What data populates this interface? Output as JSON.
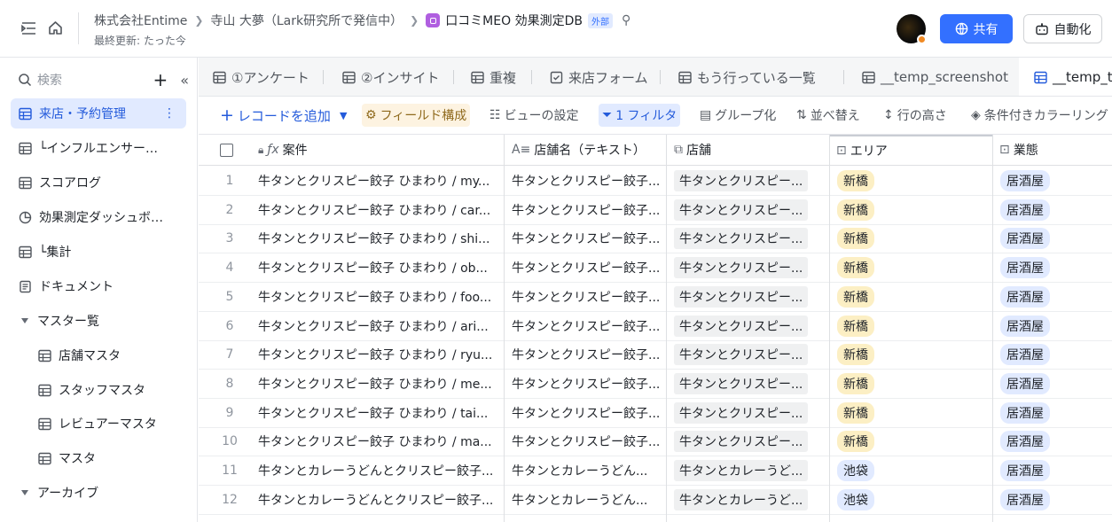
{
  "header": {
    "breadcrumbs": [
      "株式会社Entime",
      "寺山 大夢（Lark研究所で発信中）"
    ],
    "doc_title": "口コミMEO 効果測定DB",
    "external_badge": "外部",
    "last_updated": "最終更新: たった今",
    "share_label": "共有",
    "automation_label": "自動化",
    "accent": "#3370ff"
  },
  "sidebar": {
    "search_placeholder": "検索",
    "items": [
      {
        "label": "来店・予約管理",
        "icon": "table-icon",
        "active": true
      },
      {
        "label": "└インフルエンサー…",
        "icon": "table-icon"
      },
      {
        "label": "スコアログ",
        "icon": "table-icon"
      },
      {
        "label": "効果測定ダッシュボ…",
        "icon": "dashboard-icon"
      },
      {
        "label": "└集計",
        "icon": "table-icon"
      },
      {
        "label": "ドキュメント",
        "icon": "doc-icon"
      },
      {
        "label": "マスター覧",
        "icon": "folder-caret",
        "folder": true
      },
      {
        "label": "店舗マスタ",
        "icon": "table-icon",
        "sub": true
      },
      {
        "label": "スタッフマスタ",
        "icon": "table-icon",
        "sub": true
      },
      {
        "label": "レビュアーマスタ",
        "icon": "table-icon",
        "sub": true
      },
      {
        "label": "マスタ",
        "icon": "table-icon",
        "sub": true
      },
      {
        "label": "アーカイブ",
        "icon": "folder-caret",
        "folder": true
      }
    ]
  },
  "tabs": [
    {
      "label": "①アンケート",
      "icon": "table-icon"
    },
    {
      "label": "②インサイト",
      "icon": "table-icon"
    },
    {
      "label": "重複",
      "icon": "table-icon"
    },
    {
      "label": "来店フォーム",
      "icon": "form-icon"
    },
    {
      "label": "もう行っている一覧",
      "icon": "table-icon"
    },
    {
      "label": "__temp_screenshot",
      "icon": "table-icon"
    },
    {
      "label": "__temp_te",
      "icon": "table-icon",
      "active": true
    }
  ],
  "toolbar": {
    "add_record": "レコードを追加",
    "field_config": "フィールド構成",
    "view_settings": "ビューの設定",
    "filter": "1 フィルタ",
    "group": "グループ化",
    "sort": "並べ替え",
    "row_height": "行の高さ",
    "conditional_color": "条件付きカラーリング"
  },
  "table": {
    "columns": [
      "案件",
      "店舗名（テキスト）",
      "店舗",
      "エリア",
      "業態"
    ],
    "rows": [
      {
        "n": "1",
        "case": "牛タンとクリスピー餃子 ひまわり / my...",
        "shop_text": "牛タンとクリスピー餃子...",
        "shop": "牛タンとクリスピー...",
        "area": "新橋",
        "biz": "居酒屋"
      },
      {
        "n": "2",
        "case": "牛タンとクリスピー餃子 ひまわり / car...",
        "shop_text": "牛タンとクリスピー餃子...",
        "shop": "牛タンとクリスピー...",
        "area": "新橋",
        "biz": "居酒屋"
      },
      {
        "n": "3",
        "case": "牛タンとクリスピー餃子 ひまわり / shi...",
        "shop_text": "牛タンとクリスピー餃子...",
        "shop": "牛タンとクリスピー...",
        "area": "新橋",
        "biz": "居酒屋"
      },
      {
        "n": "4",
        "case": "牛タンとクリスピー餃子 ひまわり / ob...",
        "shop_text": "牛タンとクリスピー餃子...",
        "shop": "牛タンとクリスピー...",
        "area": "新橋",
        "biz": "居酒屋"
      },
      {
        "n": "5",
        "case": "牛タンとクリスピー餃子 ひまわり / foo...",
        "shop_text": "牛タンとクリスピー餃子...",
        "shop": "牛タンとクリスピー...",
        "area": "新橋",
        "biz": "居酒屋"
      },
      {
        "n": "6",
        "case": "牛タンとクリスピー餃子 ひまわり / ari...",
        "shop_text": "牛タンとクリスピー餃子...",
        "shop": "牛タンとクリスピー...",
        "area": "新橋",
        "biz": "居酒屋"
      },
      {
        "n": "7",
        "case": "牛タンとクリスピー餃子 ひまわり / ryu...",
        "shop_text": "牛タンとクリスピー餃子...",
        "shop": "牛タンとクリスピー...",
        "area": "新橋",
        "biz": "居酒屋"
      },
      {
        "n": "8",
        "case": "牛タンとクリスピー餃子 ひまわり / me...",
        "shop_text": "牛タンとクリスピー餃子...",
        "shop": "牛タンとクリスピー...",
        "area": "新橋",
        "biz": "居酒屋"
      },
      {
        "n": "9",
        "case": "牛タンとクリスピー餃子 ひまわり / tai...",
        "shop_text": "牛タンとクリスピー餃子...",
        "shop": "牛タンとクリスピー...",
        "area": "新橋",
        "biz": "居酒屋"
      },
      {
        "n": "10",
        "case": "牛タンとクリスピー餃子 ひまわり / ma...",
        "shop_text": "牛タンとクリスピー餃子...",
        "shop": "牛タンとクリスピー...",
        "area": "新橋",
        "biz": "居酒屋"
      },
      {
        "n": "11",
        "case": "牛タンとカレーうどんとクリスピー餃子...",
        "shop_text": "牛タンとカレーうどん...",
        "shop": "牛タンとカレーうど...",
        "area": "池袋",
        "biz": "居酒屋"
      },
      {
        "n": "12",
        "case": "牛タンとカレーうどんとクリスピー餃子...",
        "shop_text": "牛タンとカレーうどん...",
        "shop": "牛タンとカレーうど...",
        "area": "池袋",
        "biz": "居酒屋"
      }
    ]
  }
}
